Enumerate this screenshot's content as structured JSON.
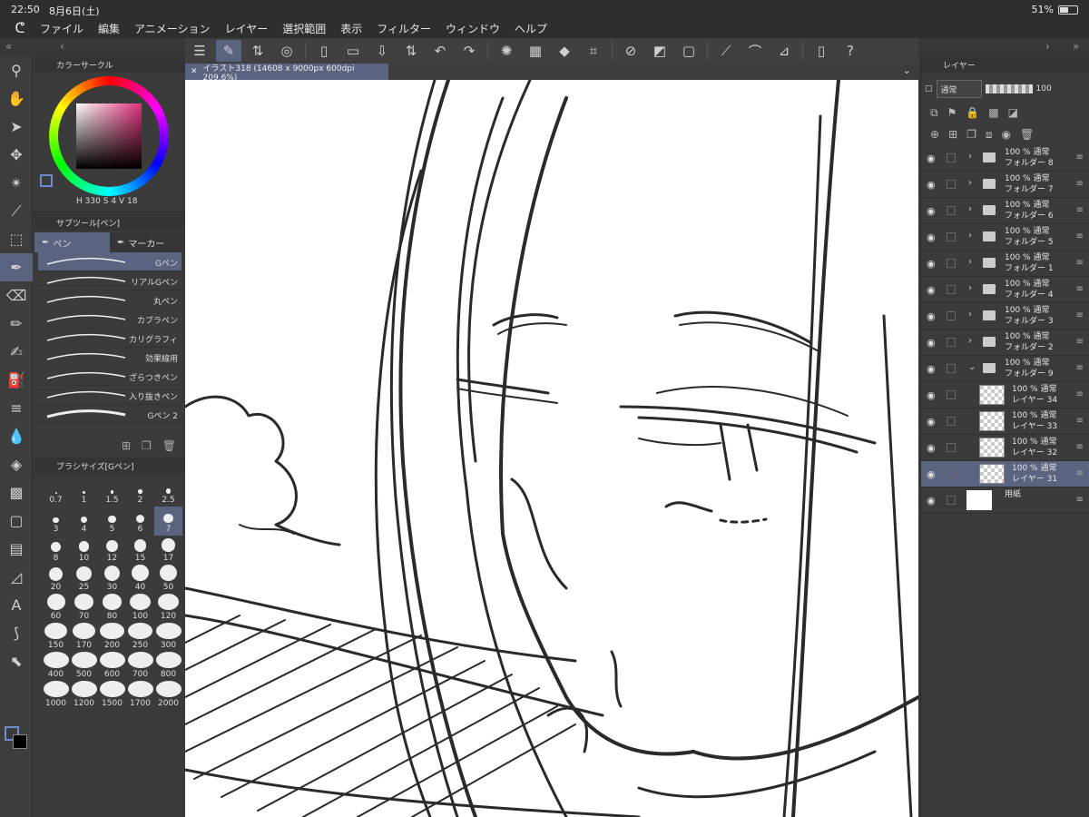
{
  "status": {
    "time": "22:50",
    "date": "8月6日(土)",
    "battery": "51%",
    "battery_level": 0.51
  },
  "menu": [
    "ファイル",
    "編集",
    "アニメーション",
    "レイヤー",
    "選択範囲",
    "表示",
    "フィルター",
    "ウィンドウ",
    "ヘルプ"
  ],
  "canvas_tab": {
    "title": "イラスト318 (14608 x 9000px 600dpi 209.6%)"
  },
  "color_panel": {
    "title": "カラーサークル",
    "h": "330",
    "s": "4",
    "v": "18",
    "labels": {
      "h": "H",
      "s": "S",
      "v": "V"
    }
  },
  "subtool": {
    "title": "サブツール[ペン]",
    "tabs": [
      {
        "label": "ペン"
      },
      {
        "label": "マーカー"
      }
    ],
    "brushes": [
      "Gペン",
      "リアルGペン",
      "丸ペン",
      "カブラペン",
      "カリグラフィ",
      "効果線用",
      "ざらつきペン",
      "入り抜きペン",
      "Gペン 2"
    ]
  },
  "brush_size": {
    "title": "ブラシサイズ[Gペン]",
    "sizes": [
      "0.7",
      "1",
      "1.5",
      "2",
      "2.5",
      "3",
      "4",
      "5",
      "6",
      "7",
      "8",
      "10",
      "12",
      "15",
      "17",
      "20",
      "25",
      "30",
      "40",
      "50",
      "60",
      "70",
      "80",
      "100",
      "120",
      "150",
      "170",
      "200",
      "250",
      "300",
      "400",
      "500",
      "600",
      "700",
      "800",
      "1000",
      "1200",
      "1500",
      "1700",
      "2000"
    ],
    "selected": "7"
  },
  "layers": {
    "title": "レイヤー",
    "blend_mode": "通常",
    "opacity": "100",
    "items": [
      {
        "line1": "100 % 通常",
        "line2": "フォルダー 8",
        "type": "folder"
      },
      {
        "line1": "100 % 通常",
        "line2": "フォルダー 7",
        "type": "folder"
      },
      {
        "line1": "100 % 通常",
        "line2": "フォルダー 6",
        "type": "folder"
      },
      {
        "line1": "100 % 通常",
        "line2": "フォルダー 5",
        "type": "folder"
      },
      {
        "line1": "100 % 通常",
        "line2": "フォルダー 1",
        "type": "folder"
      },
      {
        "line1": "100 % 通常",
        "line2": "フォルダー 4",
        "type": "folder"
      },
      {
        "line1": "100 % 通常",
        "line2": "フォルダー 3",
        "type": "folder"
      },
      {
        "line1": "100 % 通常",
        "line2": "フォルダー 2",
        "type": "folder"
      },
      {
        "line1": "100 % 通常",
        "line2": "フォルダー 9",
        "type": "folder-open"
      },
      {
        "line1": "100 % 通常",
        "line2": "レイヤー 34",
        "type": "layer"
      },
      {
        "line1": "100 % 通常",
        "line2": "レイヤー 33",
        "type": "layer"
      },
      {
        "line1": "100 % 通常",
        "line2": "レイヤー 32",
        "type": "layer"
      },
      {
        "line1": "100 % 通常",
        "line2": "レイヤー 31",
        "type": "layer-active"
      },
      {
        "line1": "",
        "line2": "用紙",
        "type": "paper"
      }
    ]
  }
}
